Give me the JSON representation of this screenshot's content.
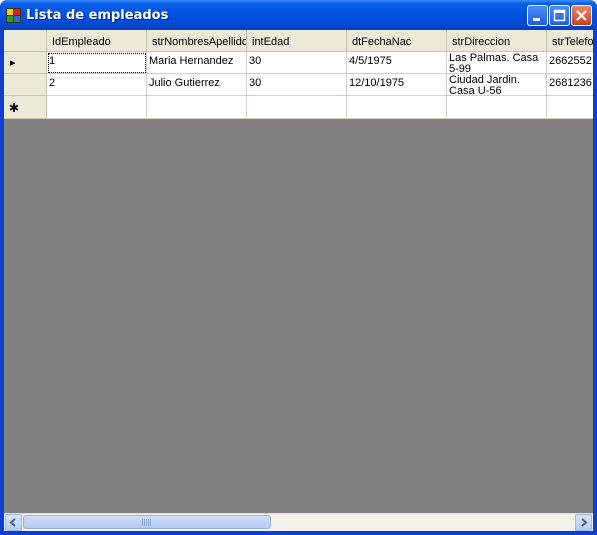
{
  "window": {
    "title": "Lista de empleados"
  },
  "grid": {
    "columns": [
      "IdEmpleado",
      "strNombresApellidos",
      "intEdad",
      "dtFechaNac",
      "strDireccion",
      "strTelefo"
    ],
    "rows": [
      [
        "1",
        "Maria Hernandez",
        "30",
        "4/5/1975",
        "Las Palmas. Casa 5-99",
        "2662552"
      ],
      [
        "2",
        "Julio Gutierrez",
        "30",
        "12/10/1975",
        "Ciudad Jardin. Casa U-56",
        "2681236"
      ]
    ],
    "row_markers": {
      "current": "▸",
      "new_row": "✱"
    }
  },
  "colors": {
    "titlebar": "#0152e0",
    "grid_background": "#808080",
    "header": "#ece9d8"
  },
  "icons": {
    "minimize": "minimize-icon",
    "maximize": "maximize-icon",
    "close": "close-icon",
    "scroll_left": "arrow-left-icon",
    "scroll_right": "arrow-right-icon"
  }
}
